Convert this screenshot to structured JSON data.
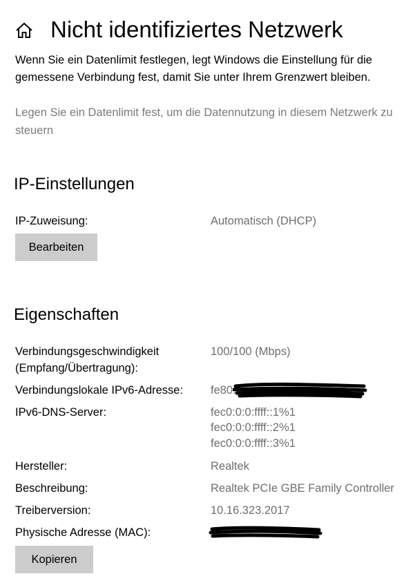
{
  "header": {
    "icon": "home-icon",
    "title": "Nicht identifiziertes Netzwerk"
  },
  "intro_text": "Wenn Sie ein Datenlimit festlegen, legt Windows die Einstellung für die gemessene Verbindung fest, damit Sie unter Ihrem Grenzwert bleiben.",
  "data_limit_link": "Legen Sie ein Datenlimit fest, um die Datennutzung in diesem Netzwerk zu steuern",
  "ip_settings": {
    "title": "IP-Einstellungen",
    "assignment_label": "IP-Zuweisung:",
    "assignment_value": "Automatisch (DHCP)",
    "edit_button": "Bearbeiten"
  },
  "properties": {
    "title": "Eigenschaften",
    "items": [
      {
        "label": "Verbindungsgeschwindigkeit",
        "label_line2": "(Empfang/Übertragung):",
        "value": "100/100 (Mbps)"
      },
      {
        "label": "Verbindungslokale IPv6-Adresse:",
        "value": "fe80::"
      },
      {
        "label": "IPv6-DNS-Server:",
        "values": [
          "fec0:0:0:ffff::1%1",
          "fec0:0:0:ffff::2%1",
          "fec0:0:0:ffff::3%1"
        ]
      },
      {
        "label": "Hersteller:",
        "value": "Realtek"
      },
      {
        "label": "Beschreibung:",
        "value": "Realtek PCIe GBE Family Controller"
      },
      {
        "label": "Treiberversion:",
        "value": "10.16.323.2017"
      },
      {
        "label": "Physische Adresse (MAC):",
        "value": ""
      }
    ],
    "copy_button": "Kopieren"
  },
  "colors": {
    "text": "#000000",
    "secondary_text": "#6e6e6e",
    "link_text": "#7a7a7a",
    "button_bg": "#cccccc",
    "background": "#ffffff"
  }
}
